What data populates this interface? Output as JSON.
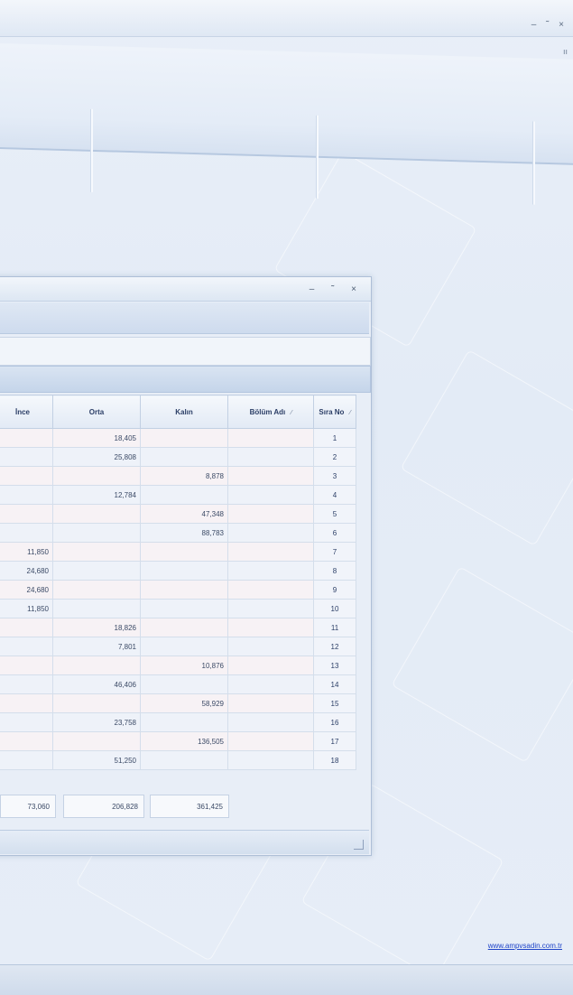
{
  "window": {
    "controls": "– ˜ ×",
    "extra": "ıı"
  },
  "inner_window": {
    "controls": "– ˜ ×"
  },
  "grid": {
    "columns": [
      "İnce",
      "Orta",
      "Kalın",
      "Bölüm Adı",
      "Sıra No"
    ],
    "rows": [
      {
        "ince": "",
        "orta": "18,405",
        "kalin": "",
        "bolum": "",
        "no": "1"
      },
      {
        "ince": "",
        "orta": "25,808",
        "kalin": "",
        "bolum": "",
        "no": "2"
      },
      {
        "ince": "",
        "orta": "",
        "kalin": "8,878",
        "bolum": "",
        "no": "3"
      },
      {
        "ince": "",
        "orta": "12,784",
        "kalin": "",
        "bolum": "",
        "no": "4"
      },
      {
        "ince": "",
        "orta": "",
        "kalin": "47,348",
        "bolum": "",
        "no": "5"
      },
      {
        "ince": "",
        "orta": "",
        "kalin": "88,783",
        "bolum": "",
        "no": "6"
      },
      {
        "ince": "11,850",
        "orta": "",
        "kalin": "",
        "bolum": "",
        "no": "7"
      },
      {
        "ince": "24,680",
        "orta": "",
        "kalin": "",
        "bolum": "",
        "no": "8"
      },
      {
        "ince": "24,680",
        "orta": "",
        "kalin": "",
        "bolum": "",
        "no": "9"
      },
      {
        "ince": "11,850",
        "orta": "",
        "kalin": "",
        "bolum": "",
        "no": "10"
      },
      {
        "ince": "",
        "orta": "18,826",
        "kalin": "",
        "bolum": "",
        "no": "11"
      },
      {
        "ince": "",
        "orta": "7,801",
        "kalin": "",
        "bolum": "",
        "no": "12"
      },
      {
        "ince": "",
        "orta": "",
        "kalin": "10,876",
        "bolum": "",
        "no": "13"
      },
      {
        "ince": "",
        "orta": "46,406",
        "kalin": "",
        "bolum": "",
        "no": "14"
      },
      {
        "ince": "",
        "orta": "",
        "kalin": "58,929",
        "bolum": "",
        "no": "15"
      },
      {
        "ince": "",
        "orta": "23,758",
        "kalin": "",
        "bolum": "",
        "no": "16"
      },
      {
        "ince": "",
        "orta": "",
        "kalin": "136,505",
        "bolum": "",
        "no": "17"
      },
      {
        "ince": "",
        "orta": "51,250",
        "kalin": "",
        "bolum": "",
        "no": "18"
      }
    ],
    "totals": {
      "ince": "73,060",
      "orta": "206,828",
      "kalin": "361,425"
    }
  },
  "footer": {
    "link": "www.ampvsadin.com.tr"
  },
  "colors": {
    "accent": "#2b3e66",
    "link": "#1f44c8",
    "background": "#e6edf7"
  }
}
